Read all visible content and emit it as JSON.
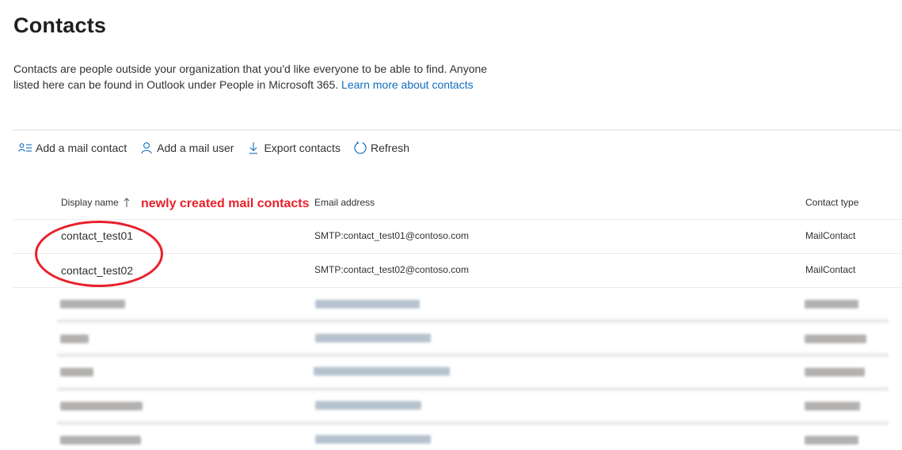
{
  "page": {
    "title": "Contacts",
    "description": "Contacts are people outside your organization that you'd like everyone to be able to find. Anyone listed here can be found in Outlook under People in Microsoft 365.",
    "learn_more": "Learn more about contacts"
  },
  "toolbar": {
    "add_mail_contact": "Add a mail contact",
    "add_mail_user": "Add a mail user",
    "export_contacts": "Export contacts",
    "refresh": "Refresh"
  },
  "table": {
    "columns": {
      "display_name": "Display name",
      "email": "Email address",
      "contact_type": "Contact type"
    },
    "rows": [
      {
        "name": "contact_test01",
        "email": "SMTP:contact_test01@contoso.com",
        "type": "MailContact"
      },
      {
        "name": "contact_test02",
        "email": "SMTP:contact_test02@contoso.com",
        "type": "MailContact"
      }
    ]
  },
  "annotation": {
    "text": "newly created mail contacts",
    "color": "#e8202b"
  },
  "icons": {
    "add_mail_contact": "contact-list-icon",
    "add_mail_user": "person-icon",
    "export_contacts": "download-arrow-icon",
    "refresh": "refresh-icon",
    "sort": "sort-ascending-arrow-icon"
  },
  "colors": {
    "link": "#0f6cbd",
    "accent": "#0f6cbd",
    "annotation": "#e8202b"
  }
}
